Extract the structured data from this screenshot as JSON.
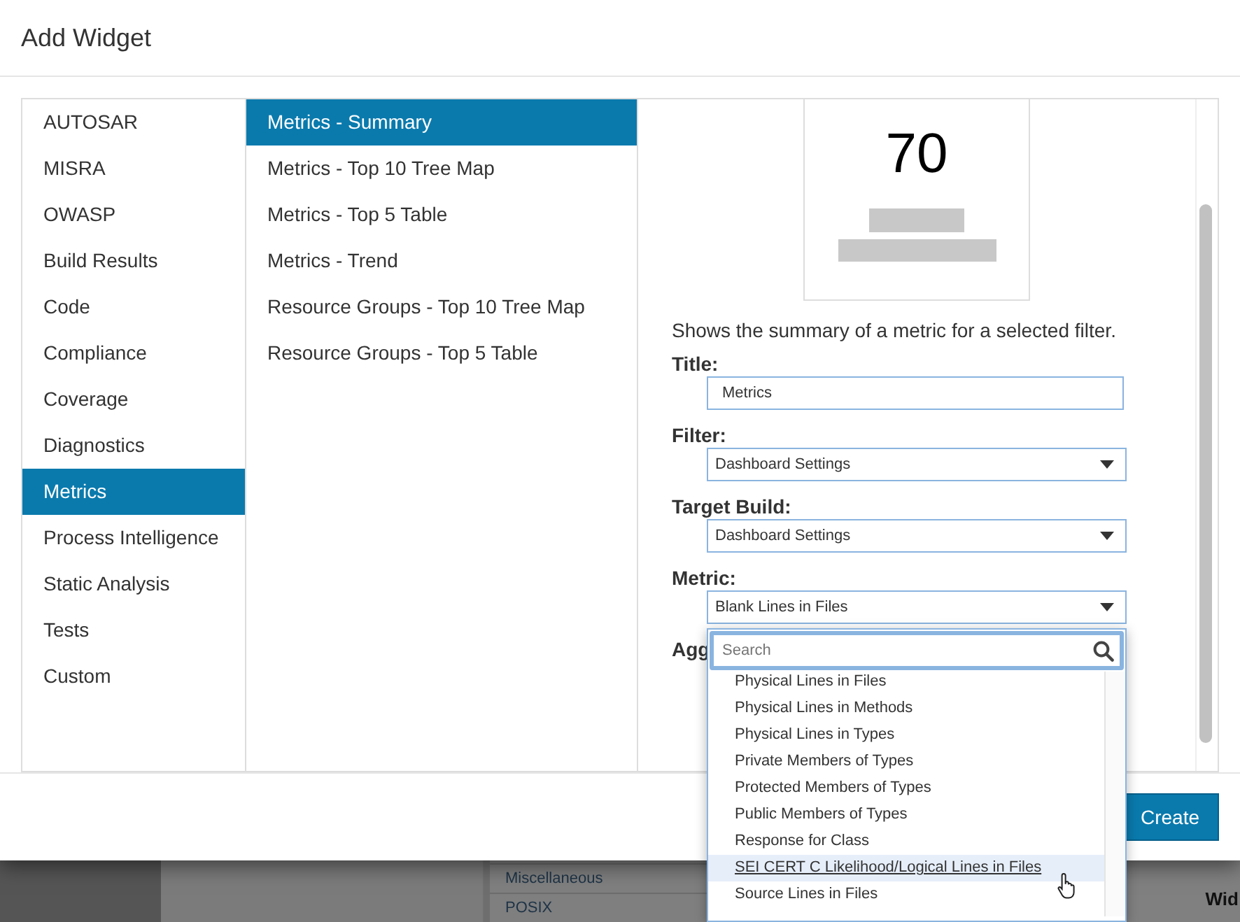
{
  "dialog": {
    "title": "Add Widget"
  },
  "categories": [
    {
      "label": "AUTOSAR",
      "selected": false
    },
    {
      "label": "MISRA",
      "selected": false
    },
    {
      "label": "OWASP",
      "selected": false
    },
    {
      "label": "Build Results",
      "selected": false
    },
    {
      "label": "Code",
      "selected": false
    },
    {
      "label": "Compliance",
      "selected": false
    },
    {
      "label": "Coverage",
      "selected": false
    },
    {
      "label": "Diagnostics",
      "selected": false
    },
    {
      "label": "Metrics",
      "selected": true
    },
    {
      "label": "Process Intelligence",
      "selected": false
    },
    {
      "label": "Static Analysis",
      "selected": false
    },
    {
      "label": "Tests",
      "selected": false
    },
    {
      "label": "Custom",
      "selected": false
    }
  ],
  "widgets": [
    {
      "label": "Metrics - Summary",
      "selected": true
    },
    {
      "label": "Metrics - Top 10 Tree Map",
      "selected": false
    },
    {
      "label": "Metrics - Top 5 Table",
      "selected": false
    },
    {
      "label": "Metrics - Trend",
      "selected": false
    },
    {
      "label": "Resource Groups - Top 10 Tree Map",
      "selected": false
    },
    {
      "label": "Resource Groups - Top 5 Table",
      "selected": false
    }
  ],
  "preview": {
    "value": "70"
  },
  "description": "Shows the summary of a metric for a selected filter.",
  "fields": [
    {
      "kind": "text",
      "label": "Title:",
      "value": "Metrics"
    },
    {
      "kind": "select",
      "label": "Filter:",
      "value": "Dashboard Settings"
    },
    {
      "kind": "select",
      "label": "Target Build:",
      "value": "Dashboard Settings"
    },
    {
      "kind": "select",
      "label": "Metric:",
      "value": "Blank Lines in Files",
      "dropdown": {
        "placeholder": "Search",
        "options": [
          {
            "label": "Physical Lines in Files",
            "highlighted": false
          },
          {
            "label": "Physical Lines in Methods",
            "highlighted": false
          },
          {
            "label": "Physical Lines in Types",
            "highlighted": false
          },
          {
            "label": "Private Members of Types",
            "highlighted": false
          },
          {
            "label": "Protected Members of Types",
            "highlighted": false
          },
          {
            "label": "Public Members of Types",
            "highlighted": false
          },
          {
            "label": "Response for Class",
            "highlighted": false
          },
          {
            "label": "SEI CERT C Likelihood/Logical Lines in Files",
            "highlighted": true
          },
          {
            "label": "Source Lines in Files",
            "highlighted": false
          }
        ]
      }
    },
    {
      "kind": "label",
      "label": "Agg"
    }
  ],
  "create_button": "Create",
  "background": {
    "list_items": [
      "Miscellaneous",
      "POSIX"
    ],
    "heading": "Wid"
  }
}
